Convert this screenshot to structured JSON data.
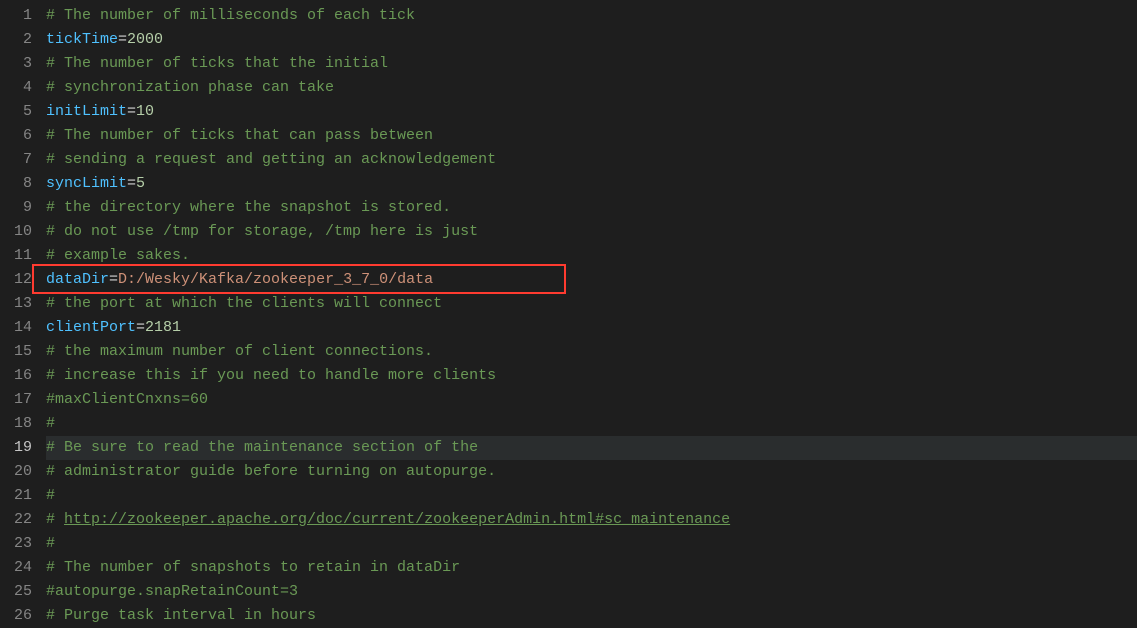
{
  "editor": {
    "currentLine": 19,
    "highlightBox": {
      "line": 12
    },
    "lines": [
      {
        "n": 1,
        "segs": [
          {
            "t": "comment",
            "v": "# The number of milliseconds of each tick"
          }
        ]
      },
      {
        "n": 2,
        "segs": [
          {
            "t": "key",
            "v": "tickTime"
          },
          {
            "t": "op",
            "v": "="
          },
          {
            "t": "num",
            "v": "2000"
          }
        ]
      },
      {
        "n": 3,
        "segs": [
          {
            "t": "comment",
            "v": "# The number of ticks that the initial"
          }
        ]
      },
      {
        "n": 4,
        "segs": [
          {
            "t": "comment",
            "v": "# synchronization phase can take"
          }
        ]
      },
      {
        "n": 5,
        "segs": [
          {
            "t": "key",
            "v": "initLimit"
          },
          {
            "t": "op",
            "v": "="
          },
          {
            "t": "num",
            "v": "10"
          }
        ]
      },
      {
        "n": 6,
        "segs": [
          {
            "t": "comment",
            "v": "# The number of ticks that can pass between"
          }
        ]
      },
      {
        "n": 7,
        "segs": [
          {
            "t": "comment",
            "v": "# sending a request and getting an acknowledgement"
          }
        ]
      },
      {
        "n": 8,
        "segs": [
          {
            "t": "key",
            "v": "syncLimit"
          },
          {
            "t": "op",
            "v": "="
          },
          {
            "t": "num",
            "v": "5"
          }
        ]
      },
      {
        "n": 9,
        "segs": [
          {
            "t": "comment",
            "v": "# the directory where the snapshot is stored."
          }
        ]
      },
      {
        "n": 10,
        "segs": [
          {
            "t": "comment",
            "v": "# do not use /tmp for storage, /tmp here is just"
          }
        ]
      },
      {
        "n": 11,
        "segs": [
          {
            "t": "comment",
            "v": "# example sakes."
          }
        ]
      },
      {
        "n": 12,
        "segs": [
          {
            "t": "key",
            "v": "dataDir"
          },
          {
            "t": "op",
            "v": "="
          },
          {
            "t": "val",
            "v": "D:/Wesky/Kafka/zookeeper_3_7_0/data"
          }
        ]
      },
      {
        "n": 13,
        "segs": [
          {
            "t": "comment",
            "v": "# the port at which the clients will connect"
          }
        ]
      },
      {
        "n": 14,
        "segs": [
          {
            "t": "key",
            "v": "clientPort"
          },
          {
            "t": "op",
            "v": "="
          },
          {
            "t": "num",
            "v": "2181"
          }
        ]
      },
      {
        "n": 15,
        "segs": [
          {
            "t": "comment",
            "v": "# the maximum number of client connections."
          }
        ]
      },
      {
        "n": 16,
        "segs": [
          {
            "t": "comment",
            "v": "# increase this if you need to handle more clients"
          }
        ]
      },
      {
        "n": 17,
        "segs": [
          {
            "t": "comment",
            "v": "#maxClientCnxns=60"
          }
        ]
      },
      {
        "n": 18,
        "segs": [
          {
            "t": "comment",
            "v": "#"
          }
        ]
      },
      {
        "n": 19,
        "segs": [
          {
            "t": "comment",
            "v": "# Be sure to read the maintenance section of the"
          }
        ]
      },
      {
        "n": 20,
        "segs": [
          {
            "t": "comment",
            "v": "# administrator guide before turning on autopurge."
          }
        ]
      },
      {
        "n": 21,
        "segs": [
          {
            "t": "comment",
            "v": "#"
          }
        ]
      },
      {
        "n": 22,
        "segs": [
          {
            "t": "comment",
            "v": "# "
          },
          {
            "t": "comment link",
            "v": "http://zookeeper.apache.org/doc/current/zookeeperAdmin.html#sc_maintenance"
          }
        ]
      },
      {
        "n": 23,
        "segs": [
          {
            "t": "comment",
            "v": "#"
          }
        ]
      },
      {
        "n": 24,
        "segs": [
          {
            "t": "comment",
            "v": "# The number of snapshots to retain in dataDir"
          }
        ]
      },
      {
        "n": 25,
        "segs": [
          {
            "t": "comment",
            "v": "#autopurge.snapRetainCount=3"
          }
        ]
      },
      {
        "n": 26,
        "segs": [
          {
            "t": "comment",
            "v": "# Purge task interval in hours"
          }
        ]
      }
    ]
  }
}
